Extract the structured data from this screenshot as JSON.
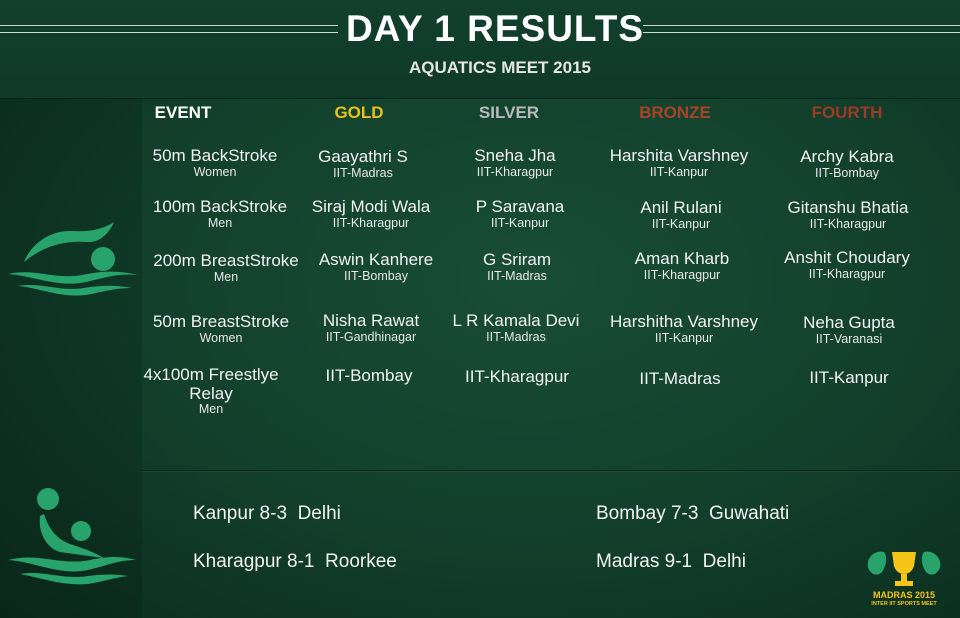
{
  "header": {
    "title": "DAY 1 RESULTS",
    "subtitle": "AQUATICS MEET 2015"
  },
  "columns": [
    {
      "label": "EVENT",
      "color": "#ffffff"
    },
    {
      "label": "GOLD",
      "color": "#e8c21f"
    },
    {
      "label": "SILVER",
      "color": "#b9bcbb"
    },
    {
      "label": "BRONZE",
      "color": "#a8432a"
    },
    {
      "label": "FOURTH",
      "color": "#9a3b25"
    }
  ],
  "rows": [
    {
      "event": {
        "name": "50m BackStroke",
        "category": "Women"
      },
      "gold": {
        "name": "Gaayathri S",
        "team": "IIT-Madras"
      },
      "silver": {
        "name": "Sneha Jha",
        "team": "IIT-Kharagpur"
      },
      "bronze": {
        "name": "Harshita Varshney",
        "team": "IIT-Kanpur"
      },
      "fourth": {
        "name": "Archy Kabra",
        "team": "IIT-Bombay"
      }
    },
    {
      "event": {
        "name": "100m BackStroke",
        "category": "Men"
      },
      "gold": {
        "name": "Siraj Modi Wala",
        "team": "IIT-Kharagpur"
      },
      "silver": {
        "name": "P Saravana",
        "team": "IIT-Kanpur"
      },
      "bronze": {
        "name": "Anil Rulani",
        "team": "IIT-Kanpur"
      },
      "fourth": {
        "name": "Gitanshu Bhatia",
        "team": "IIT-Kharagpur"
      }
    },
    {
      "event": {
        "name": "200m BreastStroke",
        "category": "Men"
      },
      "gold": {
        "name": "Aswin Kanhere",
        "team": "IIT-Bombay"
      },
      "silver": {
        "name": "G Sriram",
        "team": "IIT-Madras"
      },
      "bronze": {
        "name": "Aman Kharb",
        "team": "IIT-Kharagpur"
      },
      "fourth": {
        "name": "Anshit Choudary",
        "team": "IIT-Kharagpur"
      }
    },
    {
      "event": {
        "name": "50m BreastStroke",
        "category": "Women"
      },
      "gold": {
        "name": "Nisha Rawat",
        "team": "IIT-Gandhinagar"
      },
      "silver": {
        "name": "L R Kamala Devi",
        "team": "IIT-Madras"
      },
      "bronze": {
        "name": "Harshitha Varshney",
        "team": "IIT-Kanpur"
      },
      "fourth": {
        "name": "Neha Gupta",
        "team": "IIT-Varanasi"
      }
    },
    {
      "event": {
        "name": "4x100m Freestlye Relay",
        "category": "Men"
      },
      "gold": {
        "name": "IIT-Bombay"
      },
      "silver": {
        "name": "IIT-Kharagpur"
      },
      "bronze": {
        "name": "IIT-Madras"
      },
      "fourth": {
        "name": "IIT-Kanpur"
      }
    }
  ],
  "water_polo": [
    {
      "text": "Kanpur 8-3  Delhi"
    },
    {
      "text": "Bombay 7-3  Guwahati"
    },
    {
      "text": "Kharagpur 8-1  Roorkee"
    },
    {
      "text": "Madras 9-1  Delhi"
    }
  ],
  "logo": {
    "line1": "MADRAS 2015",
    "line2": "INTER IIT SPORTS MEET"
  },
  "icons": [
    "swimmer-icon",
    "water-polo-icon",
    "trophy-icon"
  ],
  "colors": {
    "background": "#123f2b",
    "icon_green": "#27a36b"
  }
}
